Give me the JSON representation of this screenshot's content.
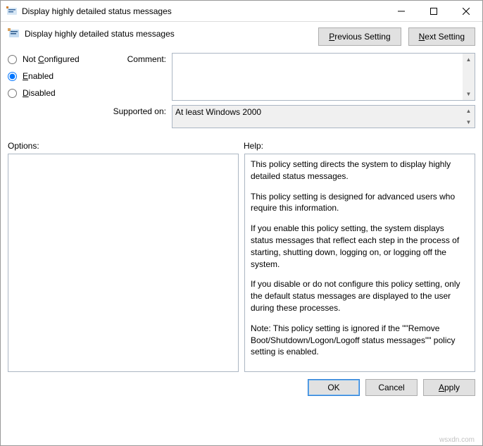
{
  "window": {
    "title": "Display highly detailed status messages"
  },
  "policy": {
    "name": "Display highly detailed status messages"
  },
  "nav": {
    "previous": "Previous Setting",
    "next": "Next Setting"
  },
  "state": {
    "not_configured": "Not Configured",
    "enabled": "Enabled",
    "disabled": "Disabled",
    "selected": "enabled"
  },
  "labels": {
    "comment": "Comment:",
    "supported_on": "Supported on:",
    "options": "Options:",
    "help": "Help:"
  },
  "fields": {
    "comment": "",
    "supported_on": "At least Windows 2000"
  },
  "help": {
    "p1": "This policy setting directs the system to display highly detailed status messages.",
    "p2": "This policy setting is designed for advanced users who require this information.",
    "p3": "If you enable this policy setting, the system displays status messages that reflect each step in the process of starting, shutting down, logging on, or logging off the system.",
    "p4": "If you disable or do not configure this policy setting, only the default status messages are displayed to the user during these processes.",
    "p5": "Note: This policy setting is ignored if the \"\"Remove Boot/Shutdown/Logon/Logoff status messages\"\" policy setting is enabled."
  },
  "buttons": {
    "ok": "OK",
    "cancel": "Cancel",
    "apply": "Apply"
  },
  "watermark": "wsxdn.com"
}
